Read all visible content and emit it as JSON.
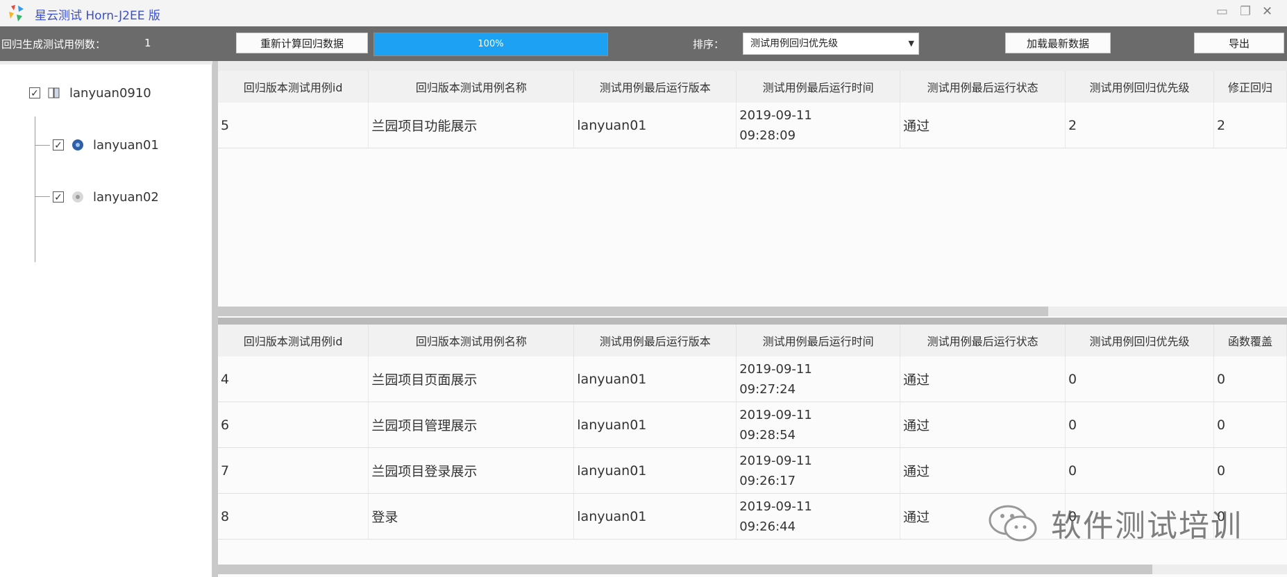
{
  "window": {
    "title": "星云测试 Horn-J2EE 版",
    "minimize_icon": "minimize-icon",
    "restore_icon": "restore-icon",
    "close_icon": "close-icon"
  },
  "toolbar": {
    "regression_count_label": "回归生成测试用例数：",
    "regression_count_value": "1",
    "calc_button": "重新计算回归数据",
    "progress_text": "100%",
    "progress_percent": 100,
    "sort_label": "排序：",
    "sort_selected": "测试用例回归优先级",
    "load_button": "加载最新数据",
    "export_button": "导出"
  },
  "tree": {
    "root": {
      "label": "lanyuan0910",
      "checked": true,
      "icon": "project-icon"
    },
    "children": [
      {
        "label": "lanyuan01",
        "checked": true,
        "icon": "version-dot-icon"
      },
      {
        "label": "lanyuan02",
        "checked": true,
        "icon": "version-dot-icon"
      }
    ]
  },
  "top_grid": {
    "columns": [
      "回归版本测试用例id",
      "回归版本测试用例名称",
      "测试用例最后运行版本",
      "测试用例最后运行时间",
      "测试用例最后运行状态",
      "测试用例回归优先级",
      "修正回归"
    ],
    "rows": [
      {
        "id": "5",
        "name": "兰园项目功能展示",
        "version": "lanyuan01",
        "date": "2019-09-11",
        "time": "09:28:09",
        "status": "通过",
        "priority": "2",
        "extra": "2"
      }
    ]
  },
  "bottom_grid": {
    "columns": [
      "回归版本测试用例id",
      "回归版本测试用例名称",
      "测试用例最后运行版本",
      "测试用例最后运行时间",
      "测试用例最后运行状态",
      "测试用例回归优先级",
      "函数覆盖"
    ],
    "rows": [
      {
        "id": "4",
        "name": "兰园项目页面展示",
        "version": "lanyuan01",
        "date": "2019-09-11",
        "time": "09:27:24",
        "status": "通过",
        "priority": "0",
        "extra": "0"
      },
      {
        "id": "6",
        "name": "兰园项目管理展示",
        "version": "lanyuan01",
        "date": "2019-09-11",
        "time": "09:28:54",
        "status": "通过",
        "priority": "0",
        "extra": "0"
      },
      {
        "id": "7",
        "name": "兰园项目登录展示",
        "version": "lanyuan01",
        "date": "2019-09-11",
        "time": "09:26:17",
        "status": "通过",
        "priority": "0",
        "extra": "0"
      },
      {
        "id": "8",
        "name": "登录",
        "version": "lanyuan01",
        "date": "2019-09-11",
        "time": "09:26:44",
        "status": "通过",
        "priority": "0",
        "extra": "0"
      }
    ]
  },
  "watermark": {
    "text": "软件测试培训"
  },
  "colors": {
    "accent": "#1da1f2",
    "toolbar": "#6b6b6b",
    "title_text": "#3a4fd0"
  }
}
